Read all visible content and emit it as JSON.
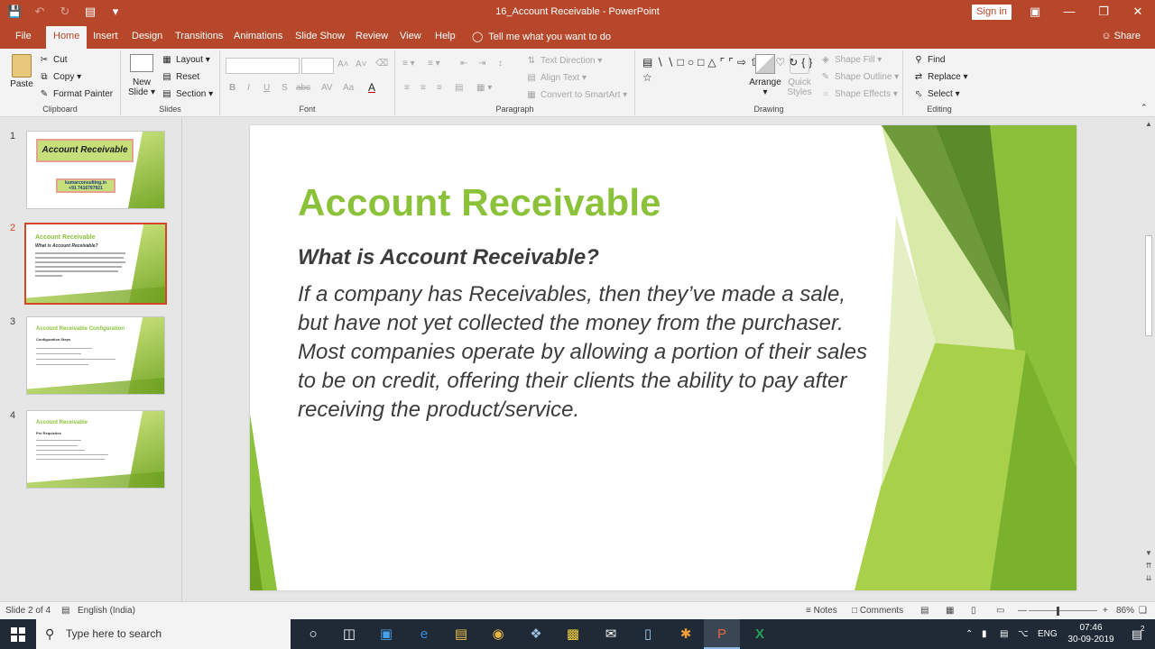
{
  "window": {
    "title": "16_Account Receivable  -  PowerPoint",
    "sign_in": "Sign in"
  },
  "tabs": [
    {
      "label": "File"
    },
    {
      "label": "Home"
    },
    {
      "label": "Insert"
    },
    {
      "label": "Design"
    },
    {
      "label": "Transitions"
    },
    {
      "label": "Animations"
    },
    {
      "label": "Slide Show"
    },
    {
      "label": "Review"
    },
    {
      "label": "View"
    },
    {
      "label": "Help"
    }
  ],
  "tell_me": "Tell me what you want to do",
  "share": "Share",
  "ribbon": {
    "clipboard": {
      "paste": "Paste",
      "cut": "Cut",
      "copy": "Copy",
      "format_painter": "Format Painter",
      "label": "Clipboard"
    },
    "slides": {
      "new_slide_1": "New",
      "new_slide_2": "Slide",
      "layout": "Layout",
      "reset": "Reset",
      "section": "Section",
      "label": "Slides"
    },
    "font": {
      "label": "Font",
      "bold": "B",
      "italic": "I",
      "underline": "U",
      "shadow": "S",
      "strike": "abc",
      "spacing": "AV",
      "case": "Aa",
      "color": "A"
    },
    "paragraph": {
      "text_direction": "Text Direction",
      "align_text": "Align Text",
      "convert": "Convert to SmartArt",
      "label": "Paragraph"
    },
    "drawing": {
      "arrange": "Arrange",
      "quick_styles_1": "Quick",
      "quick_styles_2": "Styles",
      "shape_fill": "Shape Fill",
      "shape_outline": "Shape Outline",
      "shape_effects": "Shape Effects",
      "label": "Drawing"
    },
    "editing": {
      "find": "Find",
      "replace": "Replace",
      "select": "Select",
      "label": "Editing"
    }
  },
  "thumbnails": [
    {
      "num": "1",
      "title": "Account Receivable",
      "sub1": "kumarconsulting.in",
      "sub2": "+91 7416797921"
    },
    {
      "num": "2",
      "title": "Account Receivable",
      "heading": "What is Account Receivable?"
    },
    {
      "num": "3",
      "title": "Account Receivable Configuration",
      "heading": "Configuration Steps"
    },
    {
      "num": "4",
      "title": "Account Receivable",
      "heading": "Pre Requisites"
    }
  ],
  "slide": {
    "title": "Account Receivable",
    "subtitle": "What is Account Receivable?",
    "body": "If a company has Receivables, then they’ve made a sale, but have not yet collected the money from the purchaser. Most companies operate by allowing a portion of their sales to be on credit, offering their clients the ability to pay after receiving the product/service."
  },
  "status": {
    "slide_of": "Slide 2 of 4",
    "language": "English (India)",
    "notes": "Notes",
    "comments": "Comments",
    "zoom": "86%"
  },
  "taskbar": {
    "search_placeholder": "Type here to search",
    "lang": "ENG",
    "time": "07:46",
    "date": "30-09-2019",
    "notif_count": "2"
  },
  "colors": {
    "accent": "#b7472a",
    "title_green": "#8bc23a",
    "selection": "#d24726"
  }
}
